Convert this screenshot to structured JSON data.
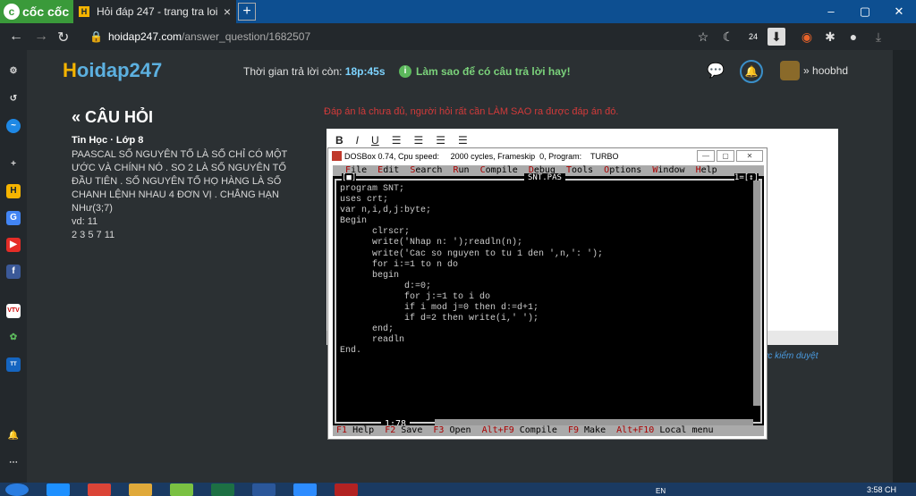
{
  "browser": {
    "brand": "cốc cốc",
    "tab_title": "Hỏi đáp 247 - trang tra loi",
    "tab_close": "×",
    "new_tab": "+",
    "url_domain": "hoidap247.com",
    "url_path": "/answer_question/1682507",
    "badge": "24"
  },
  "header": {
    "logo_h": "H",
    "logo_rest": "oidap247",
    "timer_label": "Thời gian trả lời còn: ",
    "timer_value": "18p:45s",
    "tip": "Làm sao để có câu trả lời hay!",
    "username": "hoobhd"
  },
  "question": {
    "title": "« CÂU HỎI",
    "subject": "Tin Học · Lớp 8",
    "lines": [
      "PAASCAL SỐ NGUYÊN TỐ LÀ SỐ CHỈ CÓ MỘT",
      "ƯỚC VÀ CHÍNH NÓ . SO 2 LÀ SỐ NGUYÊN TỐ",
      "ĐẦU TIÊN . SỐ NGUYÊN TỐ HỌ HÀNG LÀ SỐ",
      "CHANH LỆNH NHAU 4 ĐƠN VỊ . CHẲNG HẠN",
      "NHư(3;7)",
      "vd: 11",
      "2 3 5 7 11"
    ]
  },
  "answer": {
    "note": "Đáp án là chưa đủ, người hỏi rất cần LÀM SAO ra được đáp án đó.",
    "search_link": "ực kiểm duyệt"
  },
  "dosbox": {
    "title": "DOSBox 0.74, Cpu speed:     2000 cycles, Frameskip  0, Program:    TURBO",
    "menu": [
      "File",
      "Edit",
      "Search",
      "Run",
      "Compile",
      "Debug",
      "Tools",
      "Options",
      "Window",
      "Help"
    ],
    "filename": "SNT.PAS",
    "win_left": "[■]",
    "win_right": "1=[↕]",
    "position": "1:78",
    "code": [
      "program SNT;",
      "uses crt;",
      "var n,i,d,j:byte;",
      "Begin",
      "      clrscr;",
      "      write('Nhap n: ');readln(n);",
      "      write('Cac so nguyen to tu 1 den ',n,': ');",
      "      for i:=1 to n do",
      "      begin",
      "            d:=0;",
      "            for j:=1 to i do",
      "            if i mod j=0 then d:=d+1;",
      "            if d=2 then write(i,' ');",
      "      end;",
      "      readln",
      "End."
    ],
    "status": [
      {
        "key": "F1",
        "label": " Help  "
      },
      {
        "key": "F2",
        "label": " Save  "
      },
      {
        "key": "F3",
        "label": " Open  "
      },
      {
        "key": "Alt+F9",
        "label": " Compile  "
      },
      {
        "key": "F9",
        "label": " Make  "
      },
      {
        "key": "Alt+F10",
        "label": " Local menu"
      }
    ]
  },
  "taskbar": {
    "lang": "EN",
    "clock": "3:58 CH"
  }
}
